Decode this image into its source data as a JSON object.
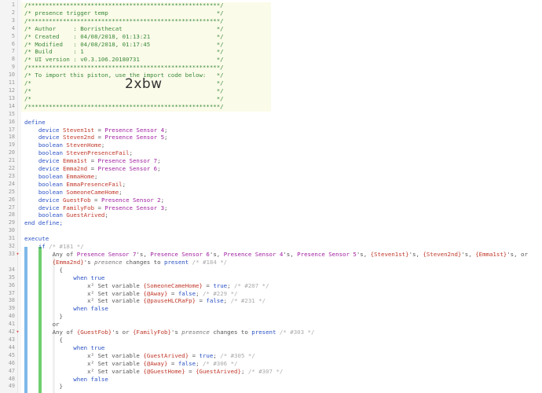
{
  "editor": {
    "header": [
      "/*******************************************************/",
      "/* presence trigger temp                               */",
      "/*******************************************************/",
      "/* Author     : Borristhecat                           */",
      "/* Created    : 04/08/2018, 01:13:21                   */",
      "/* Modified   : 04/08/2018, 01:17:45                   */",
      "/* Build      : 1                                      */",
      "/* UI version : v0.3.106.20180731                      */",
      "/*******************************************************/",
      "/* To import this piston, use the import code below:   */",
      "/*                                                     */",
      "/*                                                     */",
      "/*                                                     */",
      "/*******************************************************/"
    ],
    "import_code": "2xbw",
    "line_numbers": [
      "1",
      "2",
      "3",
      "4",
      "5",
      "6",
      "7",
      "8",
      "9",
      "10",
      "11",
      "12",
      "13",
      "14",
      "15",
      "16",
      "17",
      "18",
      "19",
      "20",
      "21",
      "22",
      "23",
      "24",
      "25",
      "26",
      "27",
      "28",
      "29",
      "30",
      "31",
      "32",
      "33",
      "",
      "34",
      "35",
      "36",
      "37",
      "38",
      "39",
      "40",
      "41",
      "42",
      "43",
      "44",
      "45",
      "46",
      "47",
      "48",
      "49"
    ],
    "define_kw": "define",
    "end_define": "end define;",
    "defines": [
      {
        "type": "device",
        "name": "Steven1st",
        "value": "Presence Sensor 4"
      },
      {
        "type": "device",
        "name": "Steven2nd",
        "value": "Presence Sensor 5"
      },
      {
        "type": "boolean",
        "name": "StevenHome",
        "value": ""
      },
      {
        "type": "boolean",
        "name": "StevenPresenceFail",
        "value": ""
      },
      {
        "type": "device",
        "name": "Emma1st",
        "value": "Presence Sensor 7"
      },
      {
        "type": "device",
        "name": "Emma2nd",
        "value": "Presence Sensor 6"
      },
      {
        "type": "boolean",
        "name": "EmmaHome",
        "value": ""
      },
      {
        "type": "boolean",
        "name": "EmmaPresenceFail",
        "value": ""
      },
      {
        "type": "boolean",
        "name": "SomeoneCameHome",
        "value": ""
      },
      {
        "type": "device",
        "name": "GuestFob",
        "value": "Presence Sensor 2"
      },
      {
        "type": "device",
        "name": "FamilyFob",
        "value": "Presence Sensor 3"
      },
      {
        "type": "boolean",
        "name": "GuestArived",
        "value": ""
      }
    ],
    "execute_kw": "execute",
    "if1": {
      "kw": "if",
      "comment": "/* #181 */"
    },
    "cond1_a": {
      "lead": "Any of ",
      "devs": [
        "Presence Sensor 7",
        "Presence Sensor 6",
        "Presence Sensor 4",
        "Presence Sensor 5"
      ],
      "vars": [
        "{Steven1st}",
        "{Steven2nd}",
        "{Emma1st}"
      ]
    },
    "cond1_b": {
      "var": "{Emma2nd}",
      "mid": "'s ",
      "prop": "presence",
      "op": " changes to ",
      "val": "present",
      "comment": "/* #184 */"
    },
    "brace_open": "{",
    "brace_close": "}",
    "when_true": "when true",
    "when_false": "when false",
    "set1": [
      {
        "var": "{SomeoneCameHome}",
        "val": "true",
        "comment": "/* #207 */"
      },
      {
        "var": "{@Away}",
        "val": "false",
        "comment": "/* #229 */"
      },
      {
        "var": "{@pauseHLCRaFp}",
        "val": "false",
        "comment": "/* #231 */"
      }
    ],
    "or_kw": "or",
    "cond2": {
      "lead": "Any of ",
      "v1": "{GuestFob}",
      "mid": "'s or ",
      "v2": "{FamilyFob}",
      "tail": "'s ",
      "prop": "presence",
      "op": " changes to ",
      "val": "present",
      "comment": "/* #303 */"
    },
    "set2": [
      {
        "var": "{GuestArived}",
        "val": "true",
        "comment": "/* #305 */"
      },
      {
        "var": "{@Away}",
        "val": "false",
        "comment": "/* #306 */"
      },
      {
        "var": "{@GuestHome}",
        "val": "{GuestArived}",
        "comment": "/* #307 */"
      }
    ],
    "set_label": "Set variable",
    "set_icon": "x²"
  }
}
